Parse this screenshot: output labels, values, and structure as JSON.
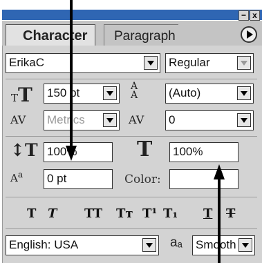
{
  "window": {
    "minimize_symbol": "−",
    "close_symbol": "x"
  },
  "tabs": {
    "active": "Character",
    "inactive": "Paragraph"
  },
  "font": {
    "family": "ErikaC",
    "style": "Regular"
  },
  "size": {
    "value": "150 pt"
  },
  "leading": {
    "value": "(Auto)"
  },
  "kerning": {
    "value": "Metrics"
  },
  "tracking": {
    "value": "0"
  },
  "vertical_scale": {
    "value": "100%"
  },
  "horizontal_scale": {
    "value": "100%"
  },
  "baseline_shift": {
    "value": "0 pt"
  },
  "color_label": "Color:",
  "style_buttons": [
    "T",
    "T",
    "TT",
    "Tт",
    "T¹",
    "T₁",
    "T",
    "T"
  ],
  "language": {
    "value": "English: USA"
  },
  "antialias": {
    "icon_text": "aₐ",
    "value": "Smooth"
  }
}
